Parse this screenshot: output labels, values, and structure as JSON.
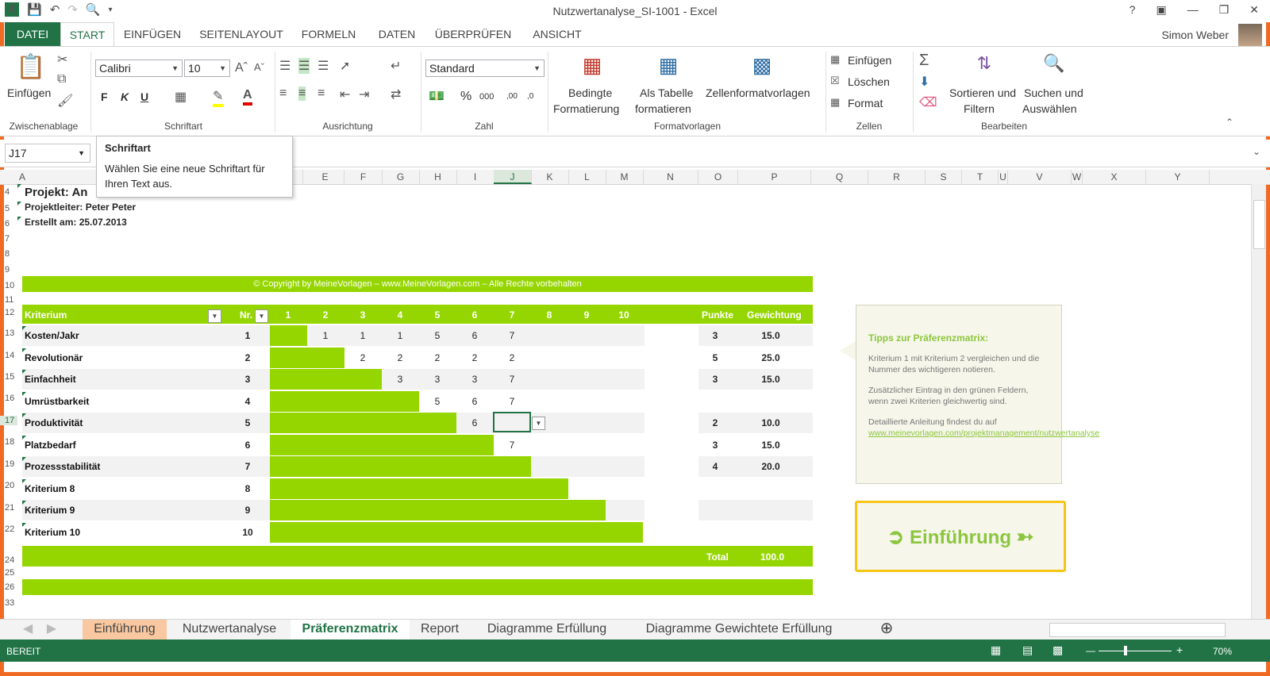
{
  "window": {
    "title": "Nutzwertanalyse_SI-1001 - Excel",
    "help": "?"
  },
  "tabs": [
    {
      "label": "DATEI"
    },
    {
      "label": "START"
    },
    {
      "label": "EINFÜGEN"
    },
    {
      "label": "SEITENLAYOUT"
    },
    {
      "label": "FORMELN"
    },
    {
      "label": "DATEN"
    },
    {
      "label": "ÜBERPRÜFEN"
    },
    {
      "label": "ANSICHT"
    }
  ],
  "user": {
    "name": "Simon Weber"
  },
  "ribbon": {
    "clipboard": {
      "label": "Zwischenablage",
      "paste": "Einfügen"
    },
    "font": {
      "label": "Schriftart",
      "name": "Calibri",
      "size": "10",
      "bold": "F",
      "italic": "K",
      "underline": "U"
    },
    "alignment": {
      "label": "Ausrichtung"
    },
    "number": {
      "label": "Zahl",
      "format": "Standard",
      "percent": "%",
      "thousands": "000",
      "inc_decimal": ",00",
      "dec_decimal": ",0"
    },
    "styles": {
      "label": "Formatvorlagen",
      "cond_fmt_1": "Bedingte",
      "cond_fmt_2": "Formatierung",
      "table_1": "Als Tabelle",
      "table_2": "formatieren",
      "cellstyles": "Zellenformatvorlagen"
    },
    "cells": {
      "label": "Zellen",
      "insert": "Einfügen",
      "delete": "Löschen",
      "format": "Format"
    },
    "editing": {
      "label": "Bearbeiten",
      "sort_1": "Sortieren und",
      "sort_2": "Filtern",
      "find_1": "Suchen und",
      "find_2": "Auswählen"
    }
  },
  "tooltip": {
    "title": "Schriftart",
    "text": "Wählen Sie eine neue Schriftart für Ihren Text aus."
  },
  "namebox": "J17",
  "columns": [
    "A",
    "E",
    "F",
    "G",
    "H",
    "I",
    "J",
    "K",
    "L",
    "M",
    "N",
    "O",
    "P",
    "Q",
    "R",
    "S",
    "T",
    "U",
    "V",
    "W",
    "X",
    "Y"
  ],
  "rows": [
    "4",
    "5",
    "6",
    "7",
    "8",
    "9",
    "10",
    "11",
    "12",
    "13",
    "14",
    "15",
    "16",
    "17",
    "18",
    "19",
    "20",
    "21",
    "22",
    "24",
    "25",
    "26",
    "33"
  ],
  "sheet": {
    "project": "Projekt: An",
    "leader": "Projektleiter: Peter Peter",
    "created": "Erstellt am: 25.07.2013",
    "copyright": "© Copyright by MeineVorlagen – www.MeineVorlagen.com – Alle Rechte vorbehalten",
    "hdr_criterion": "Kriterium",
    "hdr_nr": "Nr.",
    "hdr_cols": [
      "1",
      "2",
      "3",
      "4",
      "5",
      "6",
      "7",
      "8",
      "9",
      "10"
    ],
    "hdr_points": "Punkte",
    "hdr_weight": "Gewichtung",
    "criteria": [
      {
        "label": "Kosten/Jakr",
        "nr": "1",
        "cells": [
          "",
          "1",
          "1",
          "1",
          "5",
          "6",
          "7",
          "",
          "",
          ""
        ],
        "points": "3",
        "weight": "15.0"
      },
      {
        "label": "Revolutionär",
        "nr": "2",
        "cells": [
          "",
          "",
          "2",
          "2",
          "2",
          "2",
          "2",
          "",
          "",
          ""
        ],
        "points": "5",
        "weight": "25.0"
      },
      {
        "label": "Einfachheit",
        "nr": "3",
        "cells": [
          "",
          "",
          "",
          "3",
          "3",
          "3",
          "7",
          "",
          "",
          ""
        ],
        "points": "3",
        "weight": "15.0"
      },
      {
        "label": "Umrüstbarkeit",
        "nr": "4",
        "cells": [
          "",
          "",
          "",
          "",
          "5",
          "6",
          "7",
          "",
          "",
          ""
        ],
        "points": "",
        "weight": ""
      },
      {
        "label": "Produktivität",
        "nr": "5",
        "cells": [
          "",
          "",
          "",
          "",
          "",
          "6",
          "",
          "",
          "",
          ""
        ],
        "points": "2",
        "weight": "10.0"
      },
      {
        "label": "Platzbedarf",
        "nr": "6",
        "cells": [
          "",
          "",
          "",
          "",
          "",
          "",
          "7",
          "",
          "",
          ""
        ],
        "points": "3",
        "weight": "15.0"
      },
      {
        "label": "Prozessstabilität",
        "nr": "7",
        "cells": [
          "",
          "",
          "",
          "",
          "",
          "",
          "",
          "",
          "",
          ""
        ],
        "points": "4",
        "weight": "20.0"
      },
      {
        "label": "Kriterium 8",
        "nr": "8",
        "cells": [
          "",
          "",
          "",
          "",
          "",
          "",
          "",
          "",
          "",
          ""
        ],
        "points": "",
        "weight": ""
      },
      {
        "label": "Kriterium 9",
        "nr": "9",
        "cells": [
          "",
          "",
          "",
          "",
          "",
          "",
          "",
          "",
          "",
          ""
        ],
        "points": "",
        "weight": ""
      },
      {
        "label": "Kriterium 10",
        "nr": "10",
        "cells": [
          "",
          "",
          "",
          "",
          "",
          "",
          "",
          "",
          "",
          ""
        ],
        "points": "",
        "weight": ""
      }
    ],
    "total_label": "Total",
    "total_value": "100.0"
  },
  "tips": {
    "title": "Tipps zur Präferenzmatrix:",
    "p1": "Kriterium 1 mit Kriterium 2 vergleichen und die Nummer des wichtigeren notieren.",
    "p2": "Zusätzlicher Eintrag in den grünen Feldern, wenn zwei Kriterien gleichwertig sind.",
    "p3": "Detaillierte Anleitung findest du auf",
    "link": "www.meinevorlagen.com/projektmanagement/nutzwertanalyse"
  },
  "intro_button": "Einführung",
  "sheet_tabs": [
    {
      "label": "Einführung"
    },
    {
      "label": "Nutzwertanalyse"
    },
    {
      "label": "Präferenzmatrix"
    },
    {
      "label": "Report"
    },
    {
      "label": "Diagramme Erfüllung"
    },
    {
      "label": "Diagramme Gewichtete Erfüllung"
    }
  ],
  "status": {
    "mode": "BEREIT",
    "zoom": "70%"
  },
  "colors": {
    "excel_green": "#217346",
    "band_green": "#96d600",
    "tip_green": "#8cc63f",
    "frame_orange": "#f06a24",
    "button_border": "#f5c518"
  }
}
